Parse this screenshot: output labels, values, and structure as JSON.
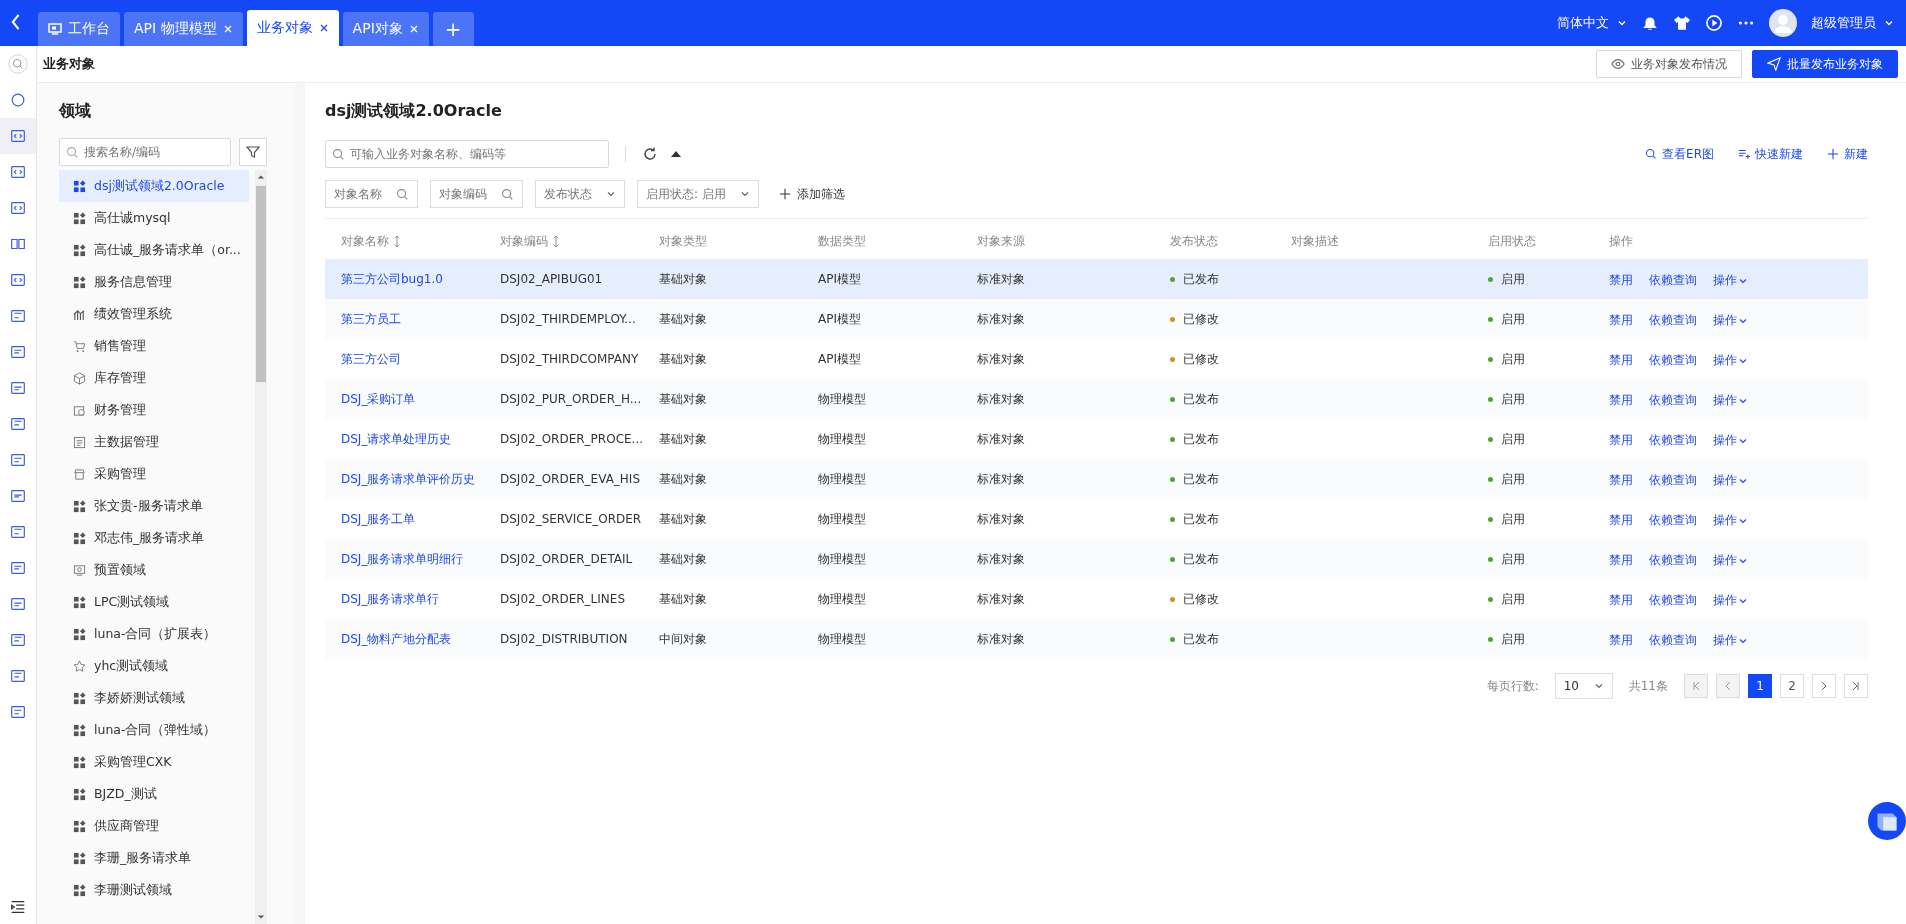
{
  "tabs": [
    {
      "label": "工作台",
      "kind": "home",
      "selected": false
    },
    {
      "label": "API 物理模型",
      "kind": "closable",
      "selected": false
    },
    {
      "label": "业务对象",
      "kind": "closable",
      "selected": true
    },
    {
      "label": "API对象",
      "kind": "closable",
      "selected": false
    }
  ],
  "new_tab": "+",
  "header_right": {
    "language": "简体中文",
    "user": "超级管理员"
  },
  "page": {
    "title": "业务对象",
    "publish_status_button": "业务对象发布情况",
    "batch_publish_button": "批量发布业务对象"
  },
  "domains": {
    "title": "领域",
    "search_placeholder": "搜索名称/编码",
    "items": [
      {
        "label": "dsj测试领域2.0Oracle",
        "kind": "grid",
        "selected": true
      },
      {
        "label": "高仕诚mysql",
        "kind": "grid",
        "selected": false
      },
      {
        "label": "高仕诚_服务请求单（or...",
        "kind": "grid",
        "selected": false
      },
      {
        "label": "服务信息管理",
        "kind": "grid",
        "selected": false
      },
      {
        "label": "绩效管理系统",
        "kind": "chart",
        "selected": false
      },
      {
        "label": "销售管理",
        "kind": "cart",
        "selected": false
      },
      {
        "label": "库存管理",
        "kind": "box",
        "selected": false
      },
      {
        "label": "财务管理",
        "kind": "finance",
        "selected": false
      },
      {
        "label": "主数据管理",
        "kind": "master",
        "selected": false
      },
      {
        "label": "采购管理",
        "kind": "shop",
        "selected": false
      },
      {
        "label": "张文贵-服务请求单",
        "kind": "grid",
        "selected": false
      },
      {
        "label": "邓志伟_服务请求单",
        "kind": "grid",
        "selected": false
      },
      {
        "label": "预置领域",
        "kind": "preset",
        "selected": false
      },
      {
        "label": "LPC测试领域",
        "kind": "grid",
        "selected": false
      },
      {
        "label": "luna-合同（扩展表）",
        "kind": "grid",
        "selected": false
      },
      {
        "label": "yhc测试领域",
        "kind": "star",
        "selected": false
      },
      {
        "label": "李娇娇测试领域",
        "kind": "grid",
        "selected": false
      },
      {
        "label": "luna-合同（弹性域）",
        "kind": "grid",
        "selected": false
      },
      {
        "label": "采购管理CXK",
        "kind": "grid",
        "selected": false
      },
      {
        "label": "BJZD_测试",
        "kind": "grid",
        "selected": false
      },
      {
        "label": "供应商管理",
        "kind": "grid",
        "selected": false
      },
      {
        "label": "李珊_服务请求单",
        "kind": "grid",
        "selected": false
      },
      {
        "label": "李珊测试领域",
        "kind": "grid",
        "selected": false
      }
    ]
  },
  "content": {
    "title": "dsj测试领域2.0Oracle",
    "search_placeholder": "可输入业务对象名称、编码等",
    "actions": [
      {
        "label": "查看ER图",
        "kind": "search"
      },
      {
        "label": "快速新建",
        "kind": "quick"
      },
      {
        "label": "新建",
        "kind": "plus"
      }
    ],
    "filters": [
      {
        "label": "对象名称",
        "kind": "search"
      },
      {
        "label": "对象编码",
        "kind": "search"
      },
      {
        "label": "发布状态",
        "kind": "select"
      },
      {
        "label": "启用状态: 启用",
        "kind": "select"
      }
    ],
    "add_filter": "添加筛选"
  },
  "table": {
    "columns": [
      {
        "label": "对象名称",
        "sortable": true
      },
      {
        "label": "对象编码",
        "sortable": true
      },
      {
        "label": "对象类型",
        "sortable": false
      },
      {
        "label": "数据类型",
        "sortable": false
      },
      {
        "label": "对象来源",
        "sortable": false
      },
      {
        "label": "发布状态",
        "sortable": false
      },
      {
        "label": "对象描述",
        "sortable": false
      },
      {
        "label": "启用状态",
        "sortable": false
      },
      {
        "label": "操作",
        "sortable": false
      }
    ],
    "rows": [
      {
        "name": "第三方公司bug1.0",
        "code": "DSJ02_APIBUG01",
        "type": "基础对象",
        "data_type": "API模型",
        "source": "标准对象",
        "publish": {
          "label": "已发布",
          "color": "#52a62a"
        },
        "enable": {
          "label": "启用",
          "color": "#52a62a"
        },
        "actions": [
          "禁用",
          "依赖查询",
          "操作"
        ],
        "selected": true
      },
      {
        "name": "第三方员工",
        "code": "DSJ02_THIRDEMPLOY...",
        "type": "基础对象",
        "data_type": "API模型",
        "source": "标准对象",
        "publish": {
          "label": "已修改",
          "color": "#e08a1e"
        },
        "enable": {
          "label": "启用",
          "color": "#52a62a"
        },
        "actions": [
          "禁用",
          "依赖查询",
          "操作"
        ],
        "selected": false
      },
      {
        "name": "第三方公司",
        "code": "DSJ02_THIRDCOMPANY",
        "type": "基础对象",
        "data_type": "API模型",
        "source": "标准对象",
        "publish": {
          "label": "已修改",
          "color": "#e08a1e"
        },
        "enable": {
          "label": "启用",
          "color": "#52a62a"
        },
        "actions": [
          "禁用",
          "依赖查询",
          "操作"
        ],
        "selected": false
      },
      {
        "name": "DSJ_采购订单",
        "code": "DSJ02_PUR_ORDER_H...",
        "type": "基础对象",
        "data_type": "物理模型",
        "source": "标准对象",
        "publish": {
          "label": "已发布",
          "color": "#52a62a"
        },
        "enable": {
          "label": "启用",
          "color": "#52a62a"
        },
        "actions": [
          "禁用",
          "依赖查询",
          "操作"
        ],
        "selected": false
      },
      {
        "name": "DSJ_请求单处理历史",
        "code": "DSJ02_ORDER_PROCE...",
        "type": "基础对象",
        "data_type": "物理模型",
        "source": "标准对象",
        "publish": {
          "label": "已发布",
          "color": "#52a62a"
        },
        "enable": {
          "label": "启用",
          "color": "#52a62a"
        },
        "actions": [
          "禁用",
          "依赖查询",
          "操作"
        ],
        "selected": false
      },
      {
        "name": "DSJ_服务请求单评价历史",
        "code": "DSJ02_ORDER_EVA_HIS",
        "type": "基础对象",
        "data_type": "物理模型",
        "source": "标准对象",
        "publish": {
          "label": "已发布",
          "color": "#52a62a"
        },
        "enable": {
          "label": "启用",
          "color": "#52a62a"
        },
        "actions": [
          "禁用",
          "依赖查询",
          "操作"
        ],
        "selected": false
      },
      {
        "name": "DSJ_服务工单",
        "code": "DSJ02_SERVICE_ORDER",
        "type": "基础对象",
        "data_type": "物理模型",
        "source": "标准对象",
        "publish": {
          "label": "已发布",
          "color": "#52a62a"
        },
        "enable": {
          "label": "启用",
          "color": "#52a62a"
        },
        "actions": [
          "禁用",
          "依赖查询",
          "操作"
        ],
        "selected": false
      },
      {
        "name": "DSJ_服务请求单明细行",
        "code": "DSJ02_ORDER_DETAIL",
        "type": "基础对象",
        "data_type": "物理模型",
        "source": "标准对象",
        "publish": {
          "label": "已发布",
          "color": "#52a62a"
        },
        "enable": {
          "label": "启用",
          "color": "#52a62a"
        },
        "actions": [
          "禁用",
          "依赖查询",
          "操作"
        ],
        "selected": false
      },
      {
        "name": "DSJ_服务请求单行",
        "code": "DSJ02_ORDER_LINES",
        "type": "基础对象",
        "data_type": "物理模型",
        "source": "标准对象",
        "publish": {
          "label": "已修改",
          "color": "#e08a1e"
        },
        "enable": {
          "label": "启用",
          "color": "#52a62a"
        },
        "actions": [
          "禁用",
          "依赖查询",
          "操作"
        ],
        "selected": false
      },
      {
        "name": "DSJ_物料产地分配表",
        "code": "DSJ02_DISTRIBUTION",
        "type": "中间对象",
        "data_type": "物理模型",
        "source": "标准对象",
        "publish": {
          "label": "已发布",
          "color": "#52a62a"
        },
        "enable": {
          "label": "启用",
          "color": "#52a62a"
        },
        "actions": [
          "禁用",
          "依赖查询",
          "操作"
        ],
        "selected": false
      }
    ]
  },
  "pagination": {
    "rows_label": "每页行数:",
    "page_size": "10",
    "total": "共11条",
    "pages": [
      {
        "label": "1",
        "selected": true
      },
      {
        "label": "2",
        "selected": false
      }
    ]
  }
}
